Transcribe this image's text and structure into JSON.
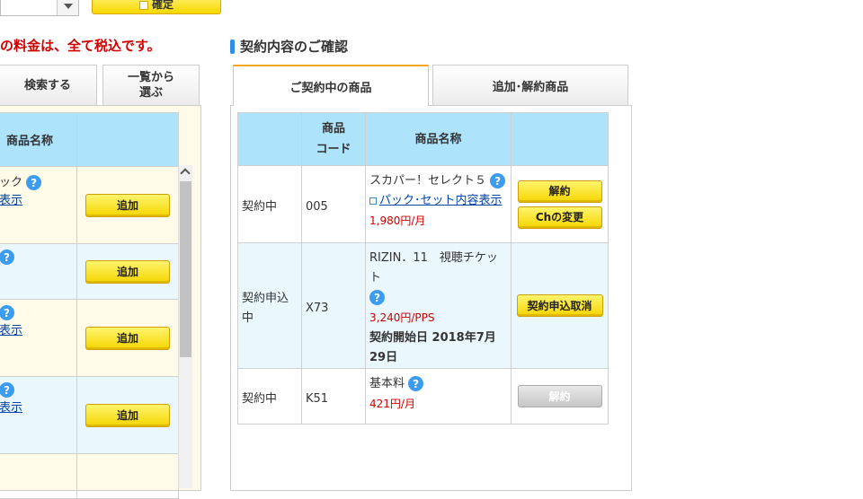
{
  "top": {
    "confirm_label": "確定"
  },
  "notice": {
    "tax_text": "の料金は、全て税込です。"
  },
  "left": {
    "tabs": [
      {
        "label": "検索する"
      },
      {
        "label": "一覧から\n選ぶ"
      }
    ],
    "table_header": "商品名称",
    "rows": [
      {
        "line1": "ック",
        "line2": "表示",
        "button": "追加"
      },
      {
        "line1": "",
        "line2": "",
        "button": "追加"
      },
      {
        "line1": "",
        "line2": "表示",
        "button": "追加"
      },
      {
        "line1": "",
        "line2": "表示",
        "button": "追加"
      }
    ]
  },
  "right": {
    "section_title": "契約内容のご確認",
    "tabs": [
      {
        "label": "ご契約中の商品"
      },
      {
        "label": "追加･解約商品"
      }
    ],
    "table": {
      "headers": {
        "status": "",
        "code": "商品\nコード",
        "name": "商品名称",
        "action": ""
      },
      "rows": [
        {
          "status": "契約中",
          "code": "005",
          "name": "スカパー！セレクト５",
          "link": "パック･セット内容表示",
          "price": "1,980円/月",
          "buttons": [
            "解約",
            "Chの変更"
          ]
        },
        {
          "status": "契約申込中",
          "code": "X73",
          "name": "RIZIN．11　視聴チケット",
          "price": "3,240円/PPS",
          "start_date": "契約開始日 2018年7月29日",
          "buttons": [
            "契約申込取消"
          ]
        },
        {
          "status": "契約中",
          "code": "K51",
          "name": "基本料",
          "price": "421円/月",
          "buttons": [
            "解約"
          ]
        }
      ]
    }
  },
  "icons": {
    "help": "?"
  },
  "colors": {
    "header_bg": "#aee4fb",
    "accent_tab": "#f5a623",
    "price_red": "#cc0000",
    "button_yellow": "#f5d600",
    "help_blue": "#3b9cf0"
  }
}
